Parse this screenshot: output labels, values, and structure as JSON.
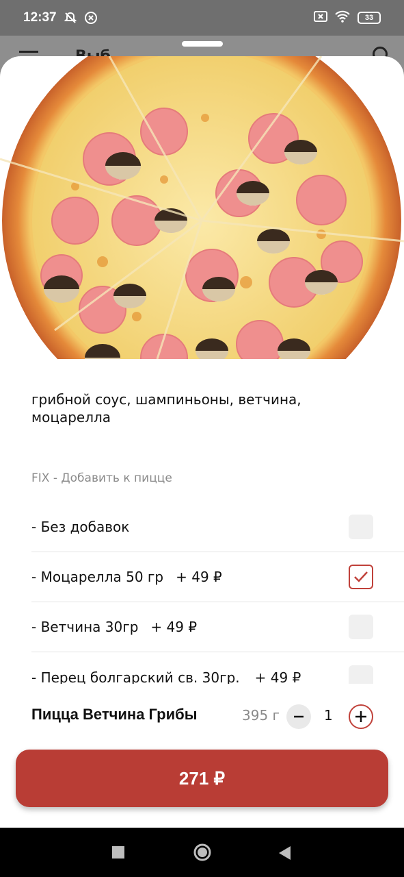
{
  "status_bar": {
    "time": "12:37",
    "battery": "33",
    "icons": [
      "mute-alarm-icon",
      "close-circle-icon",
      "sim-x-icon",
      "wifi-icon",
      "battery-icon"
    ]
  },
  "behind": {
    "title_partial": "Выб"
  },
  "product": {
    "description": "грибной соус, шампиньоны, ветчина, моцарелла",
    "section_title": "FIX - Добавить к пицце",
    "options": [
      {
        "label": "- Без добавок",
        "price": "",
        "checked": false
      },
      {
        "label": "- Моцарелла 50 гр",
        "price": "+   49 ₽",
        "checked": true
      },
      {
        "label": "- Ветчина 30гр",
        "price": "+   49 ₽",
        "checked": false
      },
      {
        "label": "- Перец болгарский св. 30гр.",
        "price": "+   49 ₽",
        "checked": false
      }
    ],
    "name": "Пицца Ветчина Грибы",
    "weight": "395 г",
    "quantity": "1"
  },
  "cart": {
    "total_label": "271 ₽"
  },
  "colors": {
    "accent": "#b93d35",
    "checkbox_checked_border": "#c0413a",
    "checkbox_bg": "#f0f0f0"
  }
}
